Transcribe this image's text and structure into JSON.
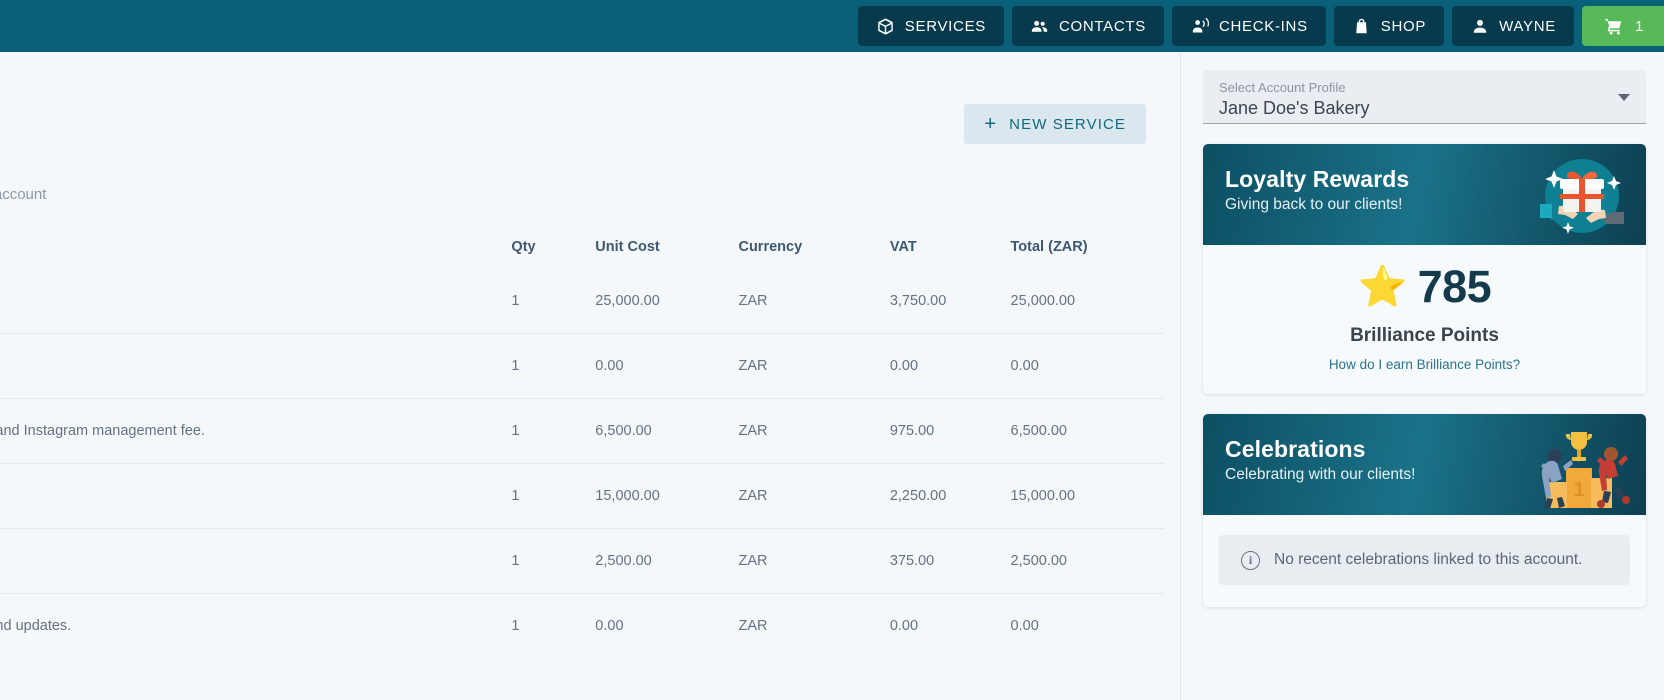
{
  "topnav": {
    "background": "#0a6079",
    "items": [
      {
        "label": "SERVICES",
        "icon": "box-icon"
      },
      {
        "label": "CONTACTS",
        "icon": "people-icon"
      },
      {
        "label": "CHECK-INS",
        "icon": "check-in-person-icon"
      },
      {
        "label": "SHOP",
        "icon": "shopping-bag-icon"
      },
      {
        "label": "WAYNE",
        "icon": "user-icon"
      }
    ],
    "cart": {
      "label": "1",
      "icon": "cart-icon",
      "color": "#57b957"
    }
  },
  "main": {
    "new_service_label": "NEW SERVICE",
    "new_service_icon": "plus-icon",
    "subtitle_cut": "our account",
    "table": {
      "headers": [
        "",
        "Qty",
        "Unit Cost",
        "Currency",
        "VAT",
        "Total (ZAR)"
      ],
      "rows": [
        {
          "desc": "",
          "qty": "1",
          "unit": "25,000.00",
          "currency": "ZAR",
          "vat": "3,750.00",
          "total": "25,000.00"
        },
        {
          "desc": "",
          "qty": "1",
          "unit": "0.00",
          "currency": "ZAR",
          "vat": "0.00",
          "total": "0.00"
        },
        {
          "desc": "ook and Instagram management fee.",
          "qty": "1",
          "unit": "6,500.00",
          "currency": "ZAR",
          "vat": "975.00",
          "total": "6,500.00"
        },
        {
          "desc": "",
          "qty": "1",
          "unit": "15,000.00",
          "currency": "ZAR",
          "vat": "2,250.00",
          "total": "15,000.00"
        },
        {
          "desc": "",
          "qty": "1",
          "unit": "2,500.00",
          "currency": "ZAR",
          "vat": "375.00",
          "total": "2,500.00"
        },
        {
          "desc": "ce and updates.",
          "qty": "1",
          "unit": "0.00",
          "currency": "ZAR",
          "vat": "0.00",
          "total": "0.00"
        }
      ]
    }
  },
  "sidebar": {
    "profile": {
      "label": "Select Account Profile",
      "value": "Jane Doe's Bakery",
      "caret_icon": "chevron-down-icon"
    },
    "loyalty": {
      "title": "Loyalty Rewards",
      "subtitle": "Giving back to our clients!",
      "art_icon": "gift-in-hands-illustration",
      "star_icon": "star-icon",
      "points": "785",
      "points_label": "Brilliance Points",
      "link": "How do I earn Brilliance Points?",
      "link_color": "#29748c"
    },
    "celebrations": {
      "title": "Celebrations",
      "subtitle": "Celebrating with our clients!",
      "art_icon": "trophy-podium-illustration",
      "empty_icon": "info-icon",
      "empty_text": "No recent celebrations linked to this account."
    }
  }
}
